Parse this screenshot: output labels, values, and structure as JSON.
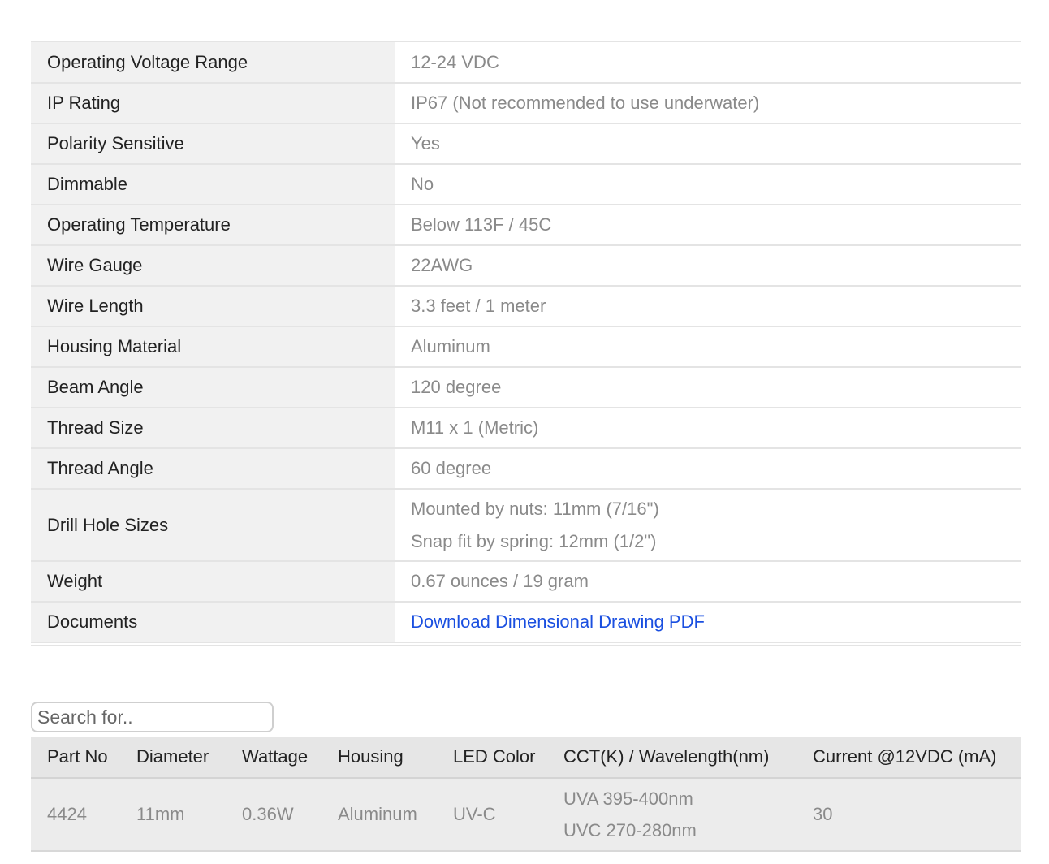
{
  "specs": [
    {
      "label": "Operating Voltage Range",
      "value": [
        "12-24 VDC"
      ]
    },
    {
      "label": "IP Rating",
      "value": [
        "IP67 (Not recommended to use underwater)"
      ]
    },
    {
      "label": "Polarity Sensitive",
      "value": [
        "Yes"
      ]
    },
    {
      "label": "Dimmable",
      "value": [
        "No"
      ]
    },
    {
      "label": "Operating Temperature",
      "value": [
        "Below 113F / 45C"
      ]
    },
    {
      "label": "Wire Gauge",
      "value": [
        "22AWG"
      ]
    },
    {
      "label": "Wire Length",
      "value": [
        "3.3 feet / 1 meter"
      ]
    },
    {
      "label": "Housing Material",
      "value": [
        "Aluminum"
      ]
    },
    {
      "label": "Beam Angle",
      "value": [
        "120 degree"
      ]
    },
    {
      "label": "Thread Size",
      "value": [
        "M11 x 1 (Metric)"
      ]
    },
    {
      "label": "Thread Angle",
      "value": [
        "60 degree"
      ]
    },
    {
      "label": "Drill Hole Sizes",
      "value": [
        "Mounted by nuts: 11mm (7/16\")",
        "Snap fit by spring: 12mm (1/2\")"
      ]
    },
    {
      "label": "Weight",
      "value": [
        "0.67 ounces / 19 gram"
      ]
    },
    {
      "label": "Documents",
      "value": [
        "Download Dimensional Drawing PDF"
      ],
      "link": true
    }
  ],
  "search": {
    "placeholder": "Search for.."
  },
  "parts": {
    "headers": [
      "Part No",
      "Diameter",
      "Wattage",
      "Housing",
      "LED Color",
      "CCT(K) / Wavelength(nm)",
      "Current @12VDC (mA)"
    ],
    "rows": [
      [
        "4424",
        "11mm",
        "0.36W",
        "Aluminum",
        "UV-C",
        [
          "UVA 395-400nm",
          "UVC 270-280nm"
        ],
        "30"
      ]
    ]
  },
  "colors": {
    "link": "#1a4fe0",
    "label_bg": "#f1f1f1",
    "value_text": "#8a8a8a"
  }
}
